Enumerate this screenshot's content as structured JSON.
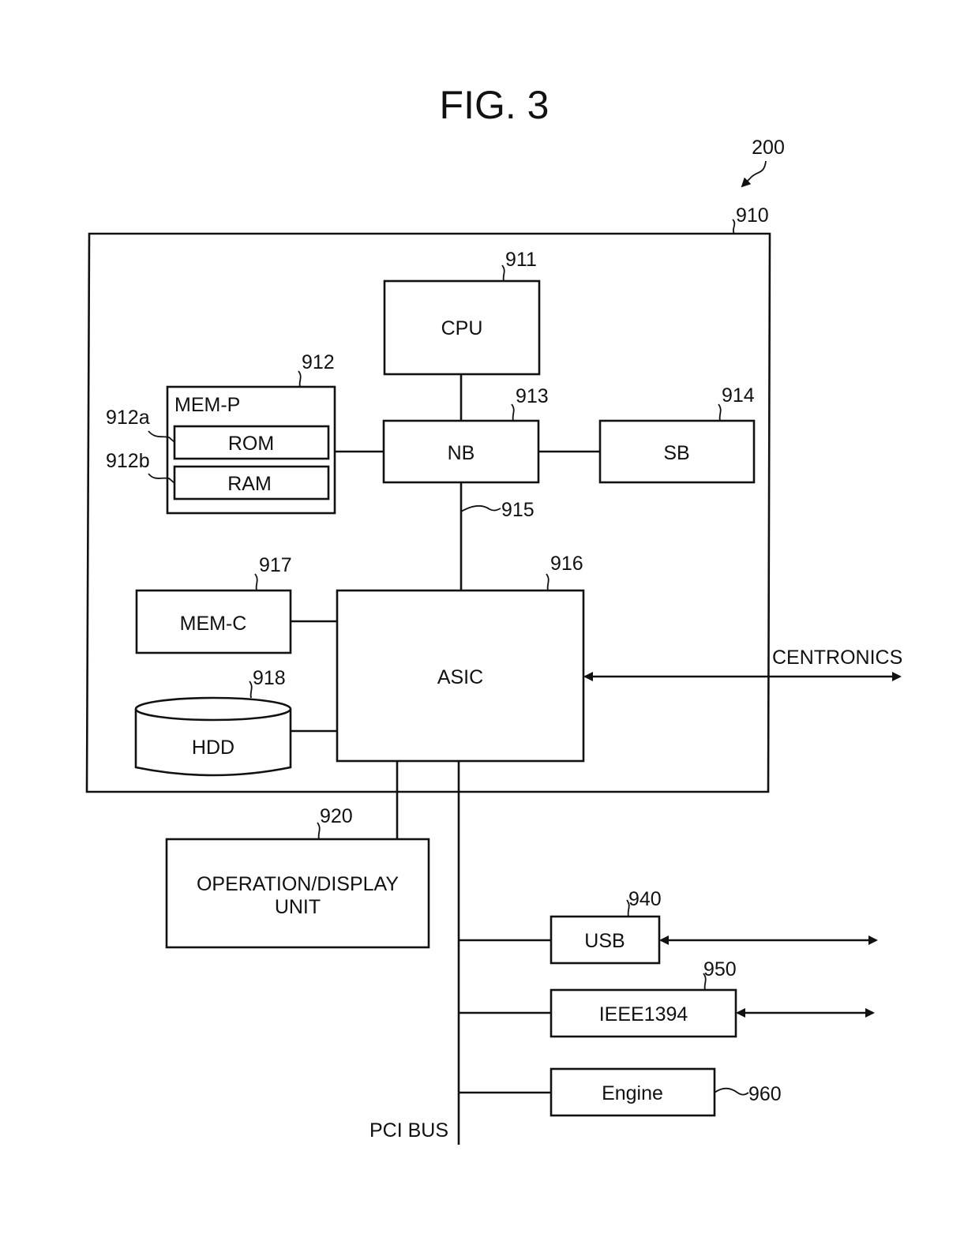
{
  "figure": {
    "title": "FIG. 3",
    "device_ref": "200"
  },
  "controller": {
    "ref": "910"
  },
  "components": {
    "cpu": {
      "label": "CPU",
      "ref": "911"
    },
    "mem_p": {
      "label": "MEM-P",
      "ref": "912"
    },
    "rom": {
      "label": "ROM",
      "ref": "912a"
    },
    "ram": {
      "label": "RAM",
      "ref": "912b"
    },
    "nb": {
      "label": "NB",
      "ref": "913"
    },
    "sb": {
      "label": "SB",
      "ref": "914"
    },
    "agp": {
      "ref": "915"
    },
    "asic": {
      "label": "ASIC",
      "ref": "916"
    },
    "mem_c": {
      "label": "MEM-C",
      "ref": "917"
    },
    "hdd": {
      "label": "HDD",
      "ref": "918"
    },
    "op_display": {
      "label_line1": "OPERATION/DISPLAY",
      "label_line2": "UNIT",
      "ref": "920"
    },
    "usb": {
      "label": "USB",
      "ref": "940"
    },
    "ieee1394": {
      "label": "IEEE1394",
      "ref": "950"
    },
    "engine": {
      "label": "Engine",
      "ref": "960"
    }
  },
  "connections": {
    "centronics": "CENTRONICS",
    "pci_bus": "PCI BUS"
  }
}
